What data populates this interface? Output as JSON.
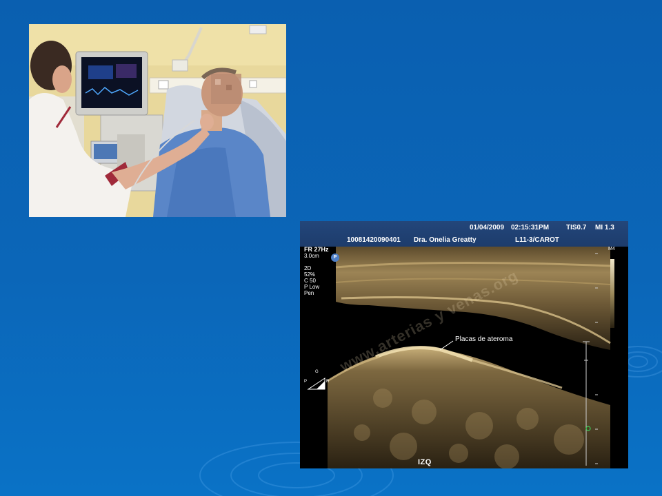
{
  "ultrasound": {
    "header": {
      "date": "01/04/2009",
      "time": "02:15:31PM",
      "tis": "TIS0.7",
      "mi": "MI 1.3",
      "patient_id": "10081420090401",
      "doctor": "Dra. Onelia Greatty",
      "probe": "L11-3/CAROT"
    },
    "params": {
      "frame_rate": "FR 27Hz",
      "depth": "3.0cm",
      "mode": "2D",
      "gain": "52%",
      "compression": "C 50",
      "power": "P Low",
      "penetration": "Pen"
    },
    "probe_badge": "P",
    "map_label": "M4",
    "annotation": "Placas de ateroma",
    "side_label": "IZQ",
    "orientation": {
      "top": "G",
      "left": "P",
      "right": "R"
    },
    "watermark": "www.arterias y venas.org",
    "colors": {
      "header": "#1d3c6c",
      "tissue": "#b59a63"
    }
  },
  "background_colors": {
    "top": "#0a5fb0",
    "bottom": "#0a72c6"
  }
}
